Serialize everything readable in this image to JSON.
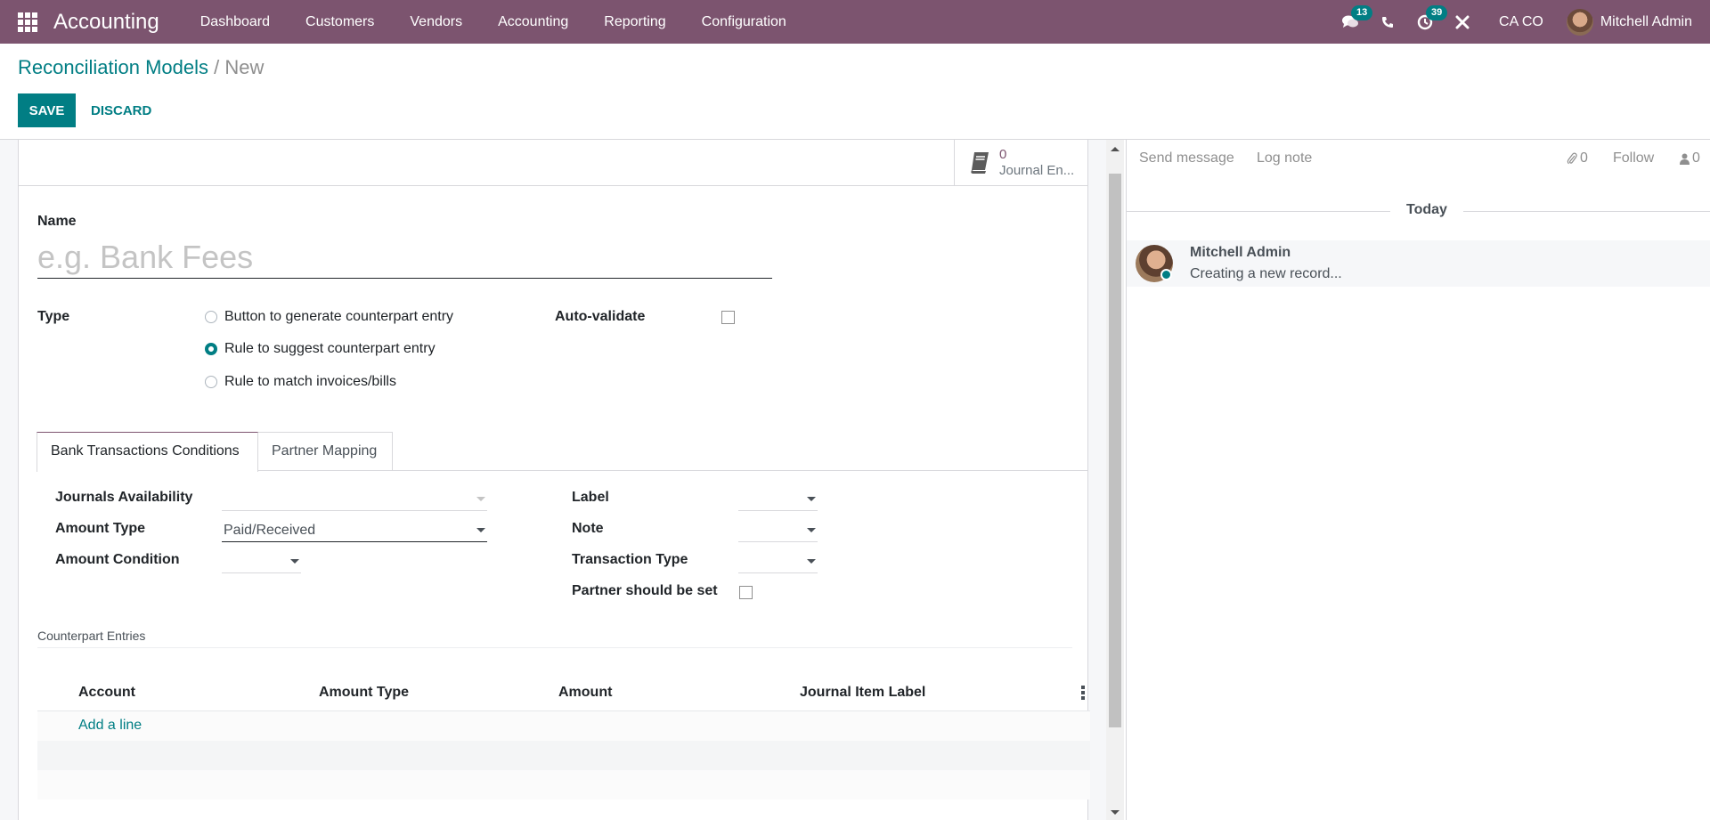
{
  "navbar": {
    "app_name": "Accounting",
    "menu": [
      "Dashboard",
      "Customers",
      "Vendors",
      "Accounting",
      "Reporting",
      "Configuration"
    ],
    "messages_badge": "13",
    "activities_badge": "39",
    "company": "CA CO",
    "user_name": "Mitchell Admin"
  },
  "breadcrumb": {
    "parent": "Reconciliation Models",
    "separator": "/",
    "current": "New"
  },
  "actions": {
    "save_label": "SAVE",
    "discard_label": "DISCARD"
  },
  "stat_button": {
    "value": "0",
    "label": "Journal En..."
  },
  "form": {
    "name_label": "Name",
    "name_value": "",
    "name_placeholder": "e.g. Bank Fees",
    "type_label": "Type",
    "type_options": [
      {
        "label": "Button to generate counterpart entry",
        "checked": false
      },
      {
        "label": "Rule to suggest counterpart entry",
        "checked": true
      },
      {
        "label": "Rule to match invoices/bills",
        "checked": false
      }
    ],
    "auto_validate_label": "Auto-validate",
    "auto_validate_checked": false
  },
  "tabs": [
    {
      "label": "Bank Transactions Conditions",
      "active": true
    },
    {
      "label": "Partner Mapping",
      "active": false
    }
  ],
  "conditions": {
    "left": [
      {
        "label": "Journals Availability",
        "value": ""
      },
      {
        "label": "Amount Type",
        "value": "Paid/Received"
      },
      {
        "label": "Amount Condition",
        "value": ""
      }
    ],
    "right": [
      {
        "label": "Label",
        "value": ""
      },
      {
        "label": "Note",
        "value": ""
      },
      {
        "label": "Transaction Type",
        "value": ""
      }
    ],
    "partner_should_be_set_label": "Partner should be set",
    "partner_should_be_set_checked": false
  },
  "counterpart": {
    "section_title": "Counterpart Entries",
    "columns": [
      "Account",
      "Amount Type",
      "Amount",
      "Journal Item Label"
    ],
    "rows": [],
    "add_line_label": "Add a line"
  },
  "chatter": {
    "send_message": "Send message",
    "log_note": "Log note",
    "attachments_count": "0",
    "follow": "Follow",
    "followers_count": "0",
    "date_separator": "Today",
    "messages": [
      {
        "author": "Mitchell Admin",
        "body": "Creating a new record..."
      }
    ]
  },
  "colors": {
    "brand": "#7c546f",
    "accent": "#017e84"
  }
}
